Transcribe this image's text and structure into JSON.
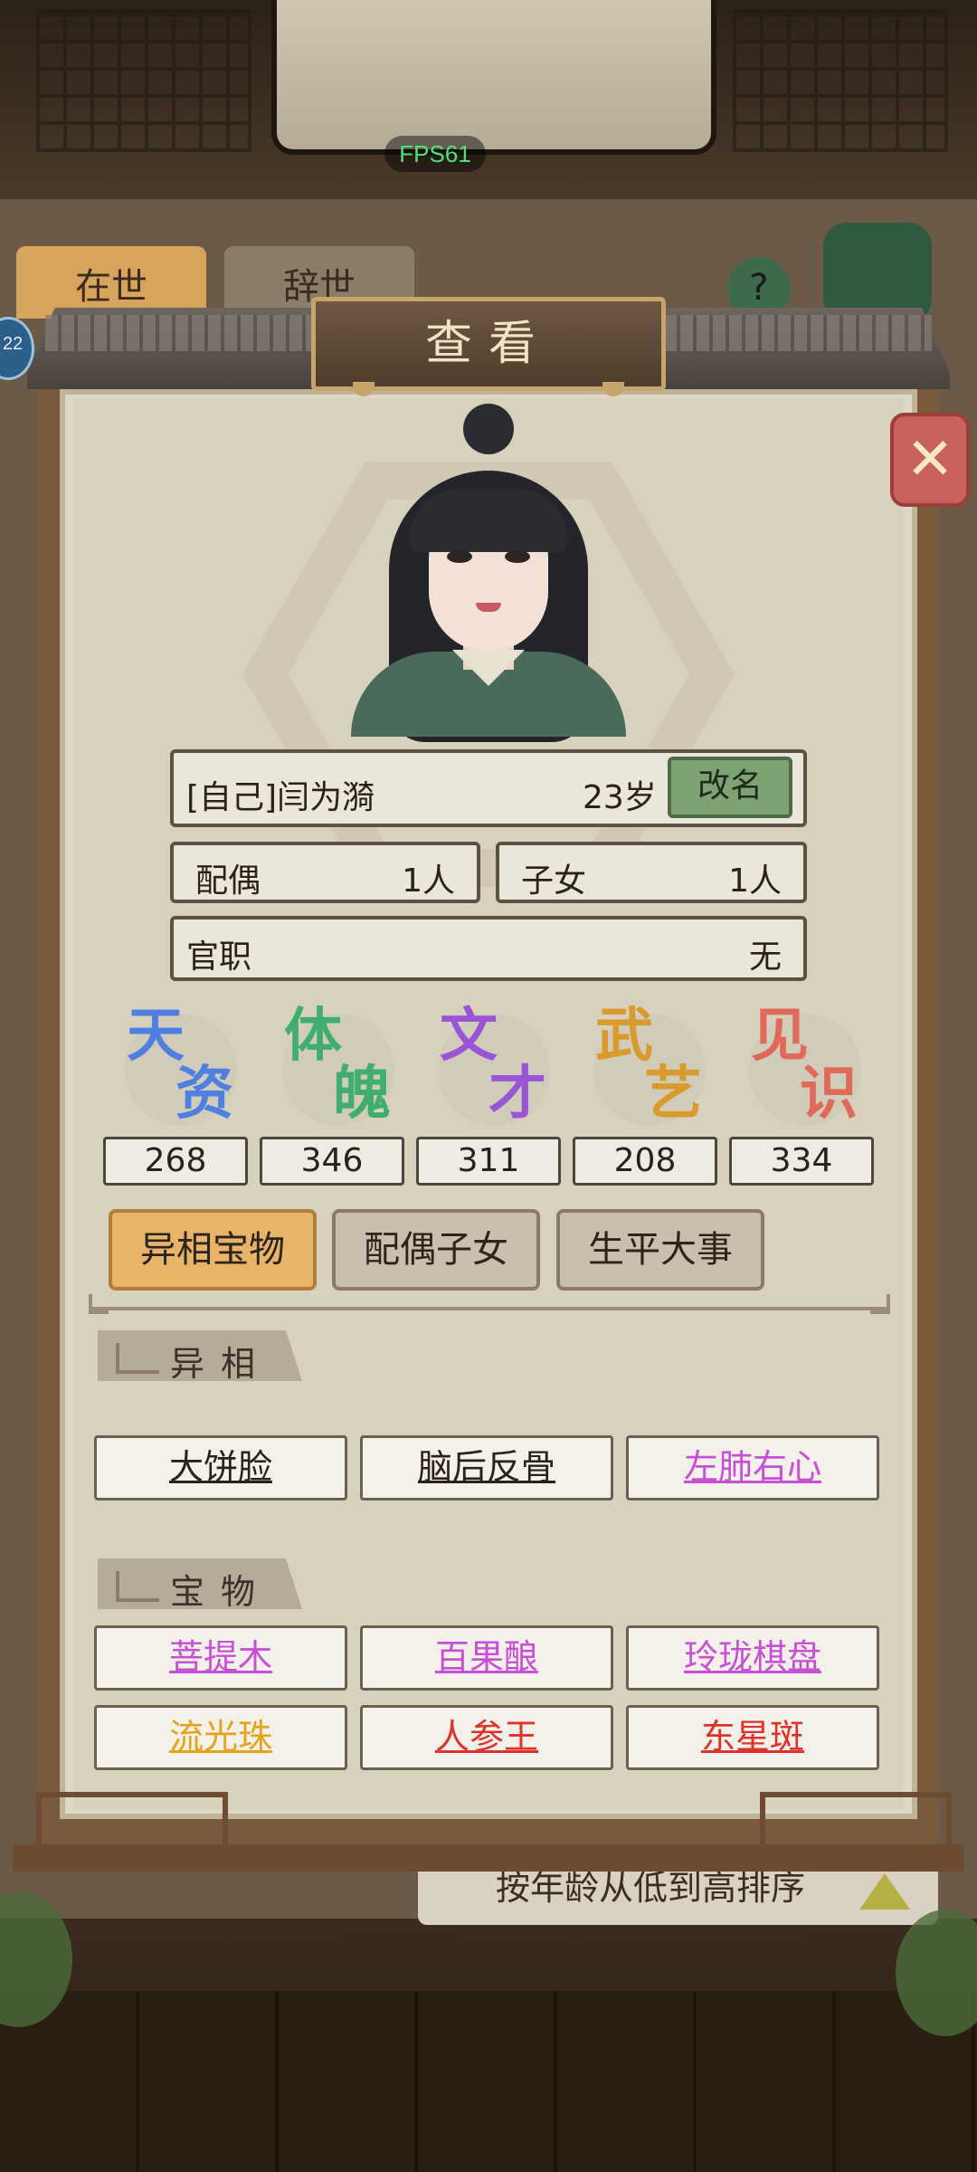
{
  "background": {
    "fps": "FPS61",
    "tabs": [
      {
        "label": "在世"
      },
      {
        "label": "辞世"
      }
    ],
    "help": "?",
    "badge": "22",
    "sort_label": "按年龄从低到高排序"
  },
  "modal": {
    "title": "查看",
    "close_icon": "close-x-icon",
    "character": {
      "name": "[自己]闫为漪",
      "age": "23岁",
      "rename_label": "改名",
      "spouse_label": "配偶",
      "spouse_value": "1人",
      "children_label": "子女",
      "children_value": "1人",
      "office_label": "官职",
      "office_value": "无"
    },
    "attributes": [
      {
        "c1": "天",
        "c2": "资",
        "value": "268",
        "color": "#4f7fe0"
      },
      {
        "c1": "体",
        "c2": "魄",
        "value": "346",
        "color": "#3fae6e"
      },
      {
        "c1": "文",
        "c2": "才",
        "value": "311",
        "color": "#9a55d6"
      },
      {
        "c1": "武",
        "c2": "艺",
        "value": "208",
        "color": "#d99a2e"
      },
      {
        "c1": "见",
        "c2": "识",
        "value": "334",
        "color": "#e06a5a"
      }
    ],
    "tabs": [
      {
        "label": "异相宝物",
        "active": true
      },
      {
        "label": "配偶子女",
        "active": false
      },
      {
        "label": "生平大事",
        "active": false
      }
    ],
    "traits_heading": "异相",
    "traits": [
      {
        "label": "大饼脸",
        "color": "#2a2119"
      },
      {
        "label": "脑后反骨",
        "color": "#2a2119"
      },
      {
        "label": "左肺右心",
        "color": "#c84fd6"
      }
    ],
    "treasures_heading": "宝物",
    "treasures": [
      {
        "label": "菩提木",
        "color": "#c84fd6"
      },
      {
        "label": "百果酿",
        "color": "#c84fd6"
      },
      {
        "label": "玲珑棋盘",
        "color": "#c84fd6"
      },
      {
        "label": "流光珠",
        "color": "#e6a21a"
      },
      {
        "label": "人参王",
        "color": "#e0322c"
      },
      {
        "label": "东星斑",
        "color": "#e0322c"
      }
    ]
  }
}
